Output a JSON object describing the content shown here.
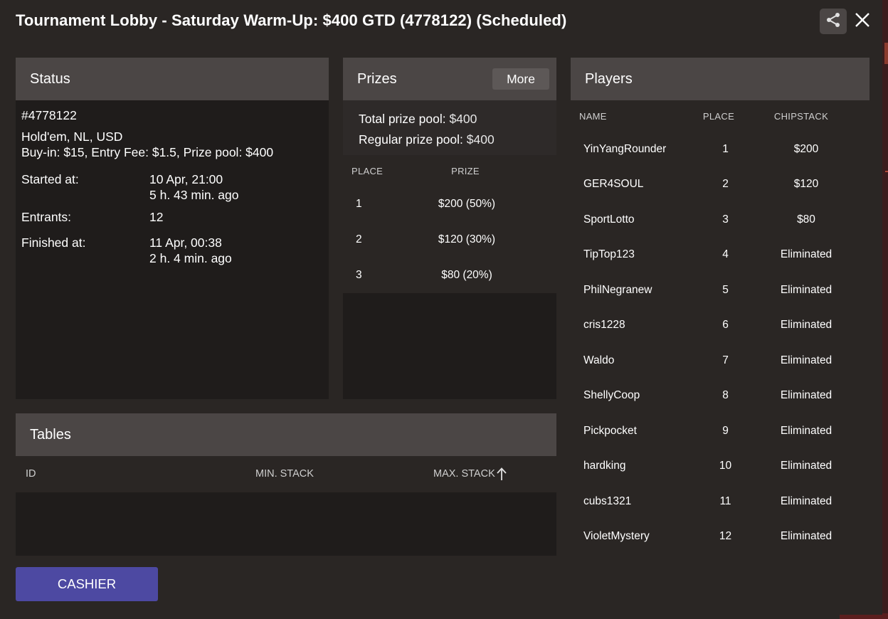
{
  "window": {
    "title": "Tournament Lobby - Saturday Warm-Up: $400 GTD (4778122) (Scheduled)"
  },
  "icons": {
    "share": "share-icon",
    "close": "close-icon",
    "sort": "arrow-up-icon"
  },
  "colors": {
    "cashier_button": "#4d49a2",
    "panel_header": "#4b4645",
    "background": "#2a2624"
  },
  "status": {
    "header": "Status",
    "id": "#4778122",
    "game": "Hold'em, NL, USD",
    "buyin": "Buy-in: $15, Entry Fee: $1.5, Prize pool: $400",
    "started_label": "Started at:",
    "started_value": "10 Apr, 21:00",
    "started_ago": "5 h. 43 min. ago",
    "entrants_label": "Entrants:",
    "entrants_value": "12",
    "finished_label": "Finished at:",
    "finished_value": "11 Apr, 00:38",
    "finished_ago": "2 h. 4 min. ago"
  },
  "prizes": {
    "header": "Prizes",
    "more_label": "More",
    "total_label": "Total prize pool:",
    "total_value": "$400",
    "regular_label": "Regular prize pool:",
    "regular_value": "$400",
    "col_place": "PLACE",
    "col_prize": "PRIZE",
    "rows": [
      {
        "place": "1",
        "prize": "$200 (50%)"
      },
      {
        "place": "2",
        "prize": "$120 (30%)"
      },
      {
        "place": "3",
        "prize": "$80 (20%)"
      }
    ]
  },
  "players": {
    "header": "Players",
    "col_name": "NAME",
    "col_place": "PLACE",
    "col_chipstack": "CHIPSTACK",
    "rows": [
      {
        "name": "YinYangRounder",
        "place": "1",
        "chips": "$200"
      },
      {
        "name": "GER4SOUL",
        "place": "2",
        "chips": "$120"
      },
      {
        "name": "SportLotto",
        "place": "3",
        "chips": "$80"
      },
      {
        "name": "TipTop123",
        "place": "4",
        "chips": "Eliminated"
      },
      {
        "name": "PhilNegranew",
        "place": "5",
        "chips": "Eliminated"
      },
      {
        "name": "cris1228",
        "place": "6",
        "chips": "Eliminated"
      },
      {
        "name": "Waldo",
        "place": "7",
        "chips": "Eliminated"
      },
      {
        "name": "ShellyCoop",
        "place": "8",
        "chips": "Eliminated"
      },
      {
        "name": "Pickpocket",
        "place": "9",
        "chips": "Eliminated"
      },
      {
        "name": "hardking",
        "place": "10",
        "chips": "Eliminated"
      },
      {
        "name": "cubs1321",
        "place": "11",
        "chips": "Eliminated"
      },
      {
        "name": "VioletMystery",
        "place": "12",
        "chips": "Eliminated"
      }
    ]
  },
  "tables": {
    "header": "Tables",
    "col_id": "ID",
    "col_min": "MIN. STACK",
    "col_max": "MAX. STACK"
  },
  "footer": {
    "cashier_label": "CASHIER"
  }
}
